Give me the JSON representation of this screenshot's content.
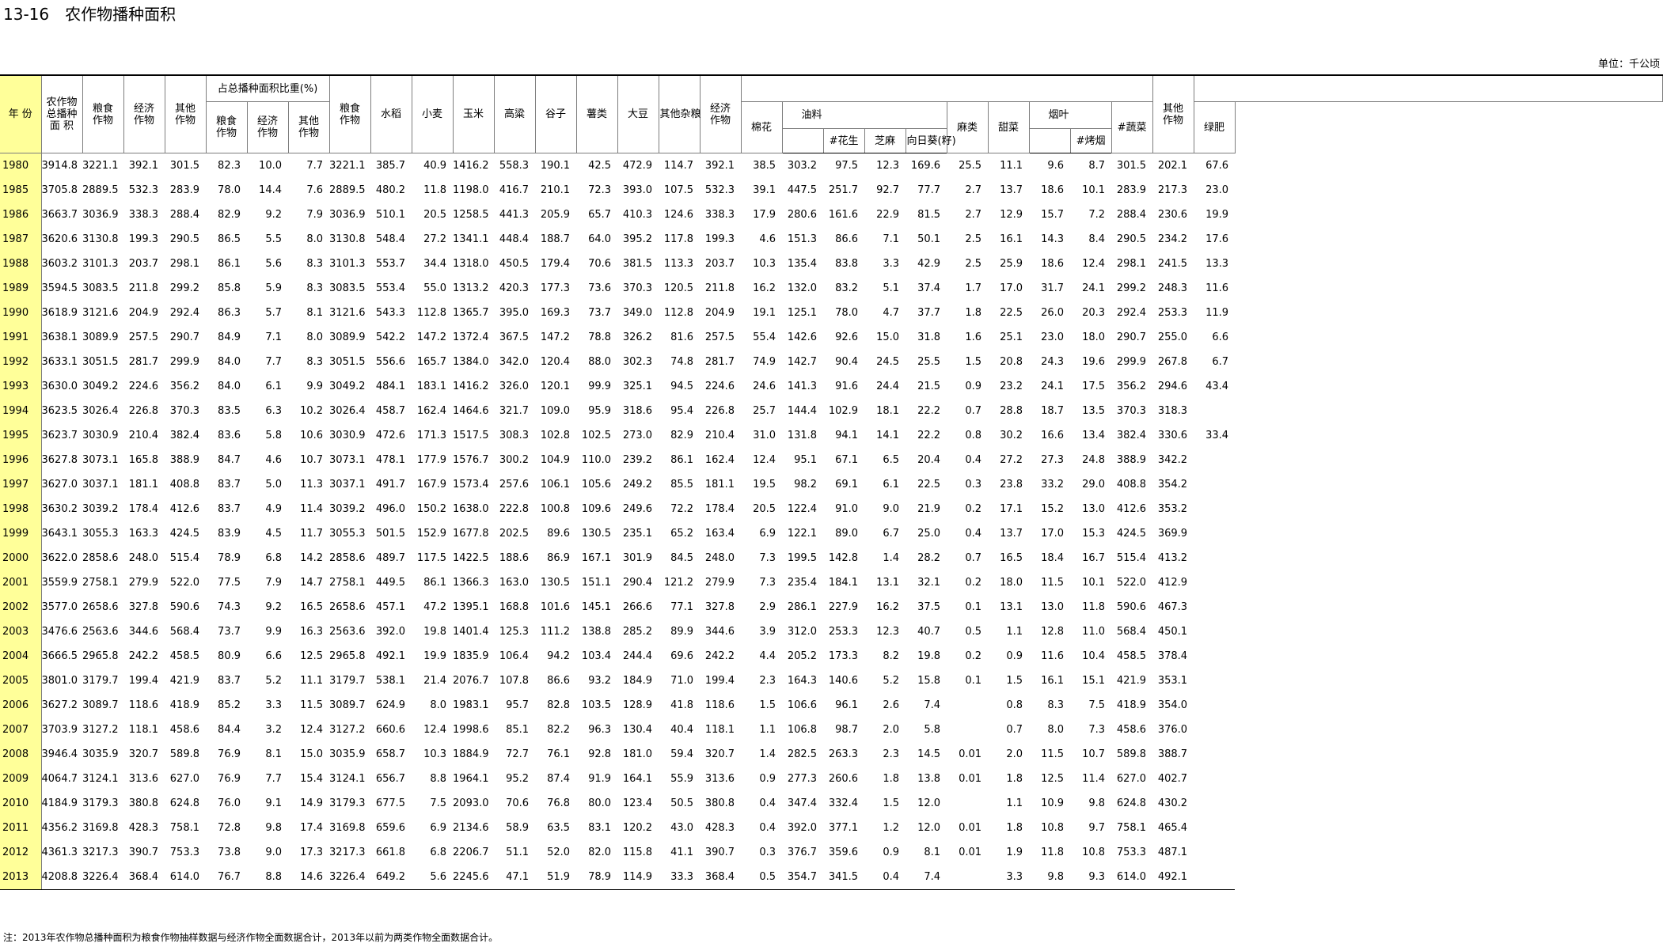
{
  "title": "13-16　农作物播种面积",
  "unit": "单位：千公顷",
  "headers": {
    "year": "年 份",
    "total": "农作物\n总播种\n面 积",
    "grain": "粮食\n作物",
    "economic": "经济\n作物",
    "other": "其他\n作物",
    "proportion_group": "占总播种面积比重(%)",
    "pct_grain": "粮食\n作物",
    "pct_economic": "经济\n作物",
    "pct_other": "其他\n作物",
    "grain2": "粮食\n作物",
    "rice": "水稻",
    "wheat": "小麦",
    "corn": "玉米",
    "sorghum": "高粱",
    "millet": "谷子",
    "tubers": "薯类",
    "soybean": "大豆",
    "other_grains": "其他杂粮",
    "economic2": "经济\n作物",
    "cotton": "棉花",
    "oil": "油料",
    "peanut": "#花生",
    "sesame": "芝麻",
    "sunflower": "向日葵(籽)",
    "hemp": "麻类",
    "beet": "甜菜",
    "tobacco": "烟叶",
    "flue_tobacco": "#烤烟",
    "other2": "其他\n作物",
    "vegetables": "#蔬菜",
    "green_manure": "绿肥"
  },
  "rows": [
    [
      "1980",
      "3914.8",
      "3221.1",
      "392.1",
      "301.5",
      "82.3",
      "10.0",
      "7.7",
      "3221.1",
      "385.7",
      "40.9",
      "1416.2",
      "558.3",
      "190.1",
      "42.5",
      "472.9",
      "114.7",
      "392.1",
      "38.5",
      "303.2",
      "97.5",
      "12.3",
      "169.6",
      "25.5",
      "11.1",
      "9.6",
      "8.7",
      "301.5",
      "202.1",
      "67.6"
    ],
    [
      "1985",
      "3705.8",
      "2889.5",
      "532.3",
      "283.9",
      "78.0",
      "14.4",
      "7.6",
      "2889.5",
      "480.2",
      "11.8",
      "1198.0",
      "416.7",
      "210.1",
      "72.3",
      "393.0",
      "107.5",
      "532.3",
      "39.1",
      "447.5",
      "251.7",
      "92.7",
      "77.7",
      "2.7",
      "13.7",
      "18.6",
      "10.1",
      "283.9",
      "217.3",
      "23.0"
    ],
    [
      "1986",
      "3663.7",
      "3036.9",
      "338.3",
      "288.4",
      "82.9",
      "9.2",
      "7.9",
      "3036.9",
      "510.1",
      "20.5",
      "1258.5",
      "441.3",
      "205.9",
      "65.7",
      "410.3",
      "124.6",
      "338.3",
      "17.9",
      "280.6",
      "161.6",
      "22.9",
      "81.5",
      "2.7",
      "12.9",
      "15.7",
      "7.2",
      "288.4",
      "230.6",
      "19.9"
    ],
    [
      "1987",
      "3620.6",
      "3130.8",
      "199.3",
      "290.5",
      "86.5",
      "5.5",
      "8.0",
      "3130.8",
      "548.4",
      "27.2",
      "1341.1",
      "448.4",
      "188.7",
      "64.0",
      "395.2",
      "117.8",
      "199.3",
      "4.6",
      "151.3",
      "86.6",
      "7.1",
      "50.1",
      "2.5",
      "16.1",
      "14.3",
      "8.4",
      "290.5",
      "234.2",
      "17.6"
    ],
    [
      "1988",
      "3603.2",
      "3101.3",
      "203.7",
      "298.1",
      "86.1",
      "5.6",
      "8.3",
      "3101.3",
      "553.7",
      "34.4",
      "1318.0",
      "450.5",
      "179.4",
      "70.6",
      "381.5",
      "113.3",
      "203.7",
      "10.3",
      "135.4",
      "83.8",
      "3.3",
      "42.9",
      "2.5",
      "25.9",
      "18.6",
      "12.4",
      "298.1",
      "241.5",
      "13.3"
    ],
    [
      "1989",
      "3594.5",
      "3083.5",
      "211.8",
      "299.2",
      "85.8",
      "5.9",
      "8.3",
      "3083.5",
      "553.4",
      "55.0",
      "1313.2",
      "420.3",
      "177.3",
      "73.6",
      "370.3",
      "120.5",
      "211.8",
      "16.2",
      "132.0",
      "83.2",
      "5.1",
      "37.4",
      "1.7",
      "17.0",
      "31.7",
      "24.1",
      "299.2",
      "248.3",
      "11.6"
    ],
    [
      "1990",
      "3618.9",
      "3121.6",
      "204.9",
      "292.4",
      "86.3",
      "5.7",
      "8.1",
      "3121.6",
      "543.3",
      "112.8",
      "1365.7",
      "395.0",
      "169.3",
      "73.7",
      "349.0",
      "112.8",
      "204.9",
      "19.1",
      "125.1",
      "78.0",
      "4.7",
      "37.7",
      "1.8",
      "22.5",
      "26.0",
      "20.3",
      "292.4",
      "253.3",
      "11.9"
    ],
    [
      "1991",
      "3638.1",
      "3089.9",
      "257.5",
      "290.7",
      "84.9",
      "7.1",
      "8.0",
      "3089.9",
      "542.2",
      "147.2",
      "1372.4",
      "367.5",
      "147.2",
      "78.8",
      "326.2",
      "81.6",
      "257.5",
      "55.4",
      "142.6",
      "92.6",
      "15.0",
      "31.8",
      "1.6",
      "25.1",
      "23.0",
      "18.0",
      "290.7",
      "255.0",
      "6.6"
    ],
    [
      "1992",
      "3633.1",
      "3051.5",
      "281.7",
      "299.9",
      "84.0",
      "7.7",
      "8.3",
      "3051.5",
      "556.6",
      "165.7",
      "1384.0",
      "342.0",
      "120.4",
      "88.0",
      "302.3",
      "74.8",
      "281.7",
      "74.9",
      "142.7",
      "90.4",
      "24.5",
      "25.5",
      "1.5",
      "20.8",
      "24.3",
      "19.6",
      "299.9",
      "267.8",
      "6.7"
    ],
    [
      "1993",
      "3630.0",
      "3049.2",
      "224.6",
      "356.2",
      "84.0",
      "6.1",
      "9.9",
      "3049.2",
      "484.1",
      "183.1",
      "1416.2",
      "326.0",
      "120.1",
      "99.9",
      "325.1",
      "94.5",
      "224.6",
      "24.6",
      "141.3",
      "91.6",
      "24.4",
      "21.5",
      "0.9",
      "23.2",
      "24.1",
      "17.5",
      "356.2",
      "294.6",
      "43.4"
    ],
    [
      "1994",
      "3623.5",
      "3026.4",
      "226.8",
      "370.3",
      "83.5",
      "6.3",
      "10.2",
      "3026.4",
      "458.7",
      "162.4",
      "1464.6",
      "321.7",
      "109.0",
      "95.9",
      "318.6",
      "95.4",
      "226.8",
      "25.7",
      "144.4",
      "102.9",
      "18.1",
      "22.2",
      "0.7",
      "28.8",
      "18.7",
      "13.5",
      "370.3",
      "318.3",
      ""
    ],
    [
      "1995",
      "3623.7",
      "3030.9",
      "210.4",
      "382.4",
      "83.6",
      "5.8",
      "10.6",
      "3030.9",
      "472.6",
      "171.3",
      "1517.5",
      "308.3",
      "102.8",
      "102.5",
      "273.0",
      "82.9",
      "210.4",
      "31.0",
      "131.8",
      "94.1",
      "14.1",
      "22.2",
      "0.8",
      "30.2",
      "16.6",
      "13.4",
      "382.4",
      "330.6",
      "33.4"
    ],
    [
      "1996",
      "3627.8",
      "3073.1",
      "165.8",
      "388.9",
      "84.7",
      "4.6",
      "10.7",
      "3073.1",
      "478.1",
      "177.9",
      "1576.7",
      "300.2",
      "104.9",
      "110.0",
      "239.2",
      "86.1",
      "162.4",
      "12.4",
      "95.1",
      "67.1",
      "6.5",
      "20.4",
      "0.4",
      "27.2",
      "27.3",
      "24.8",
      "388.9",
      "342.2",
      ""
    ],
    [
      "1997",
      "3627.0",
      "3037.1",
      "181.1",
      "408.8",
      "83.7",
      "5.0",
      "11.3",
      "3037.1",
      "491.7",
      "167.9",
      "1573.4",
      "257.6",
      "106.1",
      "105.6",
      "249.2",
      "85.5",
      "181.1",
      "19.5",
      "98.2",
      "69.1",
      "6.1",
      "22.5",
      "0.3",
      "23.8",
      "33.2",
      "29.0",
      "408.8",
      "354.2",
      ""
    ],
    [
      "1998",
      "3630.2",
      "3039.2",
      "178.4",
      "412.6",
      "83.7",
      "4.9",
      "11.4",
      "3039.2",
      "496.0",
      "150.2",
      "1638.0",
      "222.8",
      "100.8",
      "109.6",
      "249.6",
      "72.2",
      "178.4",
      "20.5",
      "122.4",
      "91.0",
      "9.0",
      "21.9",
      "0.2",
      "17.1",
      "15.2",
      "13.0",
      "412.6",
      "353.2",
      ""
    ],
    [
      "1999",
      "3643.1",
      "3055.3",
      "163.3",
      "424.5",
      "83.9",
      "4.5",
      "11.7",
      "3055.3",
      "501.5",
      "152.9",
      "1677.8",
      "202.5",
      "89.6",
      "130.5",
      "235.1",
      "65.2",
      "163.4",
      "6.9",
      "122.1",
      "89.0",
      "6.7",
      "25.0",
      "0.4",
      "13.7",
      "17.0",
      "15.3",
      "424.5",
      "369.9",
      ""
    ],
    [
      "2000",
      "3622.0",
      "2858.6",
      "248.0",
      "515.4",
      "78.9",
      "6.8",
      "14.2",
      "2858.6",
      "489.7",
      "117.5",
      "1422.5",
      "188.6",
      "86.9",
      "167.1",
      "301.9",
      "84.5",
      "248.0",
      "7.3",
      "199.5",
      "142.8",
      "1.4",
      "28.2",
      "0.7",
      "16.5",
      "18.4",
      "16.7",
      "515.4",
      "413.2",
      ""
    ],
    [
      "2001",
      "3559.9",
      "2758.1",
      "279.9",
      "522.0",
      "77.5",
      "7.9",
      "14.7",
      "2758.1",
      "449.5",
      "86.1",
      "1366.3",
      "163.0",
      "130.5",
      "151.1",
      "290.4",
      "121.2",
      "279.9",
      "7.3",
      "235.4",
      "184.1",
      "13.1",
      "32.1",
      "0.2",
      "18.0",
      "11.5",
      "10.1",
      "522.0",
      "412.9",
      ""
    ],
    [
      "2002",
      "3577.0",
      "2658.6",
      "327.8",
      "590.6",
      "74.3",
      "9.2",
      "16.5",
      "2658.6",
      "457.1",
      "47.2",
      "1395.1",
      "168.8",
      "101.6",
      "145.1",
      "266.6",
      "77.1",
      "327.8",
      "2.9",
      "286.1",
      "227.9",
      "16.2",
      "37.5",
      "0.1",
      "13.1",
      "13.0",
      "11.8",
      "590.6",
      "467.3",
      ""
    ],
    [
      "2003",
      "3476.6",
      "2563.6",
      "344.6",
      "568.4",
      "73.7",
      "9.9",
      "16.3",
      "2563.6",
      "392.0",
      "19.8",
      "1401.4",
      "125.3",
      "111.2",
      "138.8",
      "285.2",
      "89.9",
      "344.6",
      "3.9",
      "312.0",
      "253.3",
      "12.3",
      "40.7",
      "0.5",
      "1.1",
      "12.8",
      "11.0",
      "568.4",
      "450.1",
      ""
    ],
    [
      "2004",
      "3666.5",
      "2965.8",
      "242.2",
      "458.5",
      "80.9",
      "6.6",
      "12.5",
      "2965.8",
      "492.1",
      "19.9",
      "1835.9",
      "106.4",
      "94.2",
      "103.4",
      "244.4",
      "69.6",
      "242.2",
      "4.4",
      "205.2",
      "173.3",
      "8.2",
      "19.8",
      "0.2",
      "0.9",
      "11.6",
      "10.4",
      "458.5",
      "378.4",
      ""
    ],
    [
      "2005",
      "3801.0",
      "3179.7",
      "199.4",
      "421.9",
      "83.7",
      "5.2",
      "11.1",
      "3179.7",
      "538.1",
      "21.4",
      "2076.7",
      "107.8",
      "86.6",
      "93.2",
      "184.9",
      "71.0",
      "199.4",
      "2.3",
      "164.3",
      "140.6",
      "5.2",
      "15.8",
      "0.1",
      "1.5",
      "16.1",
      "15.1",
      "421.9",
      "353.1",
      ""
    ],
    [
      "2006",
      "3627.2",
      "3089.7",
      "118.6",
      "418.9",
      "85.2",
      "3.3",
      "11.5",
      "3089.7",
      "624.9",
      "8.0",
      "1983.1",
      "95.7",
      "82.8",
      "103.5",
      "128.9",
      "41.8",
      "118.6",
      "1.5",
      "106.6",
      "96.1",
      "2.6",
      "7.4",
      "",
      "0.8",
      "8.3",
      "7.5",
      "418.9",
      "354.0",
      ""
    ],
    [
      "2007",
      "3703.9",
      "3127.2",
      "118.1",
      "458.6",
      "84.4",
      "3.2",
      "12.4",
      "3127.2",
      "660.6",
      "12.4",
      "1998.6",
      "85.1",
      "82.2",
      "96.3",
      "130.4",
      "40.4",
      "118.1",
      "1.1",
      "106.8",
      "98.7",
      "2.0",
      "5.8",
      "",
      "0.7",
      "8.0",
      "7.3",
      "458.6",
      "376.0",
      ""
    ],
    [
      "2008",
      "3946.4",
      "3035.9",
      "320.7",
      "589.8",
      "76.9",
      "8.1",
      "15.0",
      "3035.9",
      "658.7",
      "10.3",
      "1884.9",
      "72.7",
      "76.1",
      "92.8",
      "181.0",
      "59.4",
      "320.7",
      "1.4",
      "282.5",
      "263.3",
      "2.3",
      "14.5",
      "0.01",
      "2.0",
      "11.5",
      "10.7",
      "589.8",
      "388.7",
      ""
    ],
    [
      "2009",
      "4064.7",
      "3124.1",
      "313.6",
      "627.0",
      "76.9",
      "7.7",
      "15.4",
      "3124.1",
      "656.7",
      "8.8",
      "1964.1",
      "95.2",
      "87.4",
      "91.9",
      "164.1",
      "55.9",
      "313.6",
      "0.9",
      "277.3",
      "260.6",
      "1.8",
      "13.8",
      "0.01",
      "1.8",
      "12.5",
      "11.4",
      "627.0",
      "402.7",
      ""
    ],
    [
      "2010",
      "4184.9",
      "3179.3",
      "380.8",
      "624.8",
      "76.0",
      "9.1",
      "14.9",
      "3179.3",
      "677.5",
      "7.5",
      "2093.0",
      "70.6",
      "76.8",
      "80.0",
      "123.4",
      "50.5",
      "380.8",
      "0.4",
      "347.4",
      "332.4",
      "1.5",
      "12.0",
      "",
      "1.1",
      "10.9",
      "9.8",
      "624.8",
      "430.2",
      ""
    ],
    [
      "2011",
      "4356.2",
      "3169.8",
      "428.3",
      "758.1",
      "72.8",
      "9.8",
      "17.4",
      "3169.8",
      "659.6",
      "6.9",
      "2134.6",
      "58.9",
      "63.5",
      "83.1",
      "120.2",
      "43.0",
      "428.3",
      "0.4",
      "392.0",
      "377.1",
      "1.2",
      "12.0",
      "0.01",
      "1.8",
      "10.8",
      "9.7",
      "758.1",
      "465.4",
      ""
    ],
    [
      "2012",
      "4361.3",
      "3217.3",
      "390.7",
      "753.3",
      "73.8",
      "9.0",
      "17.3",
      "3217.3",
      "661.8",
      "6.8",
      "2206.7",
      "51.1",
      "52.0",
      "82.0",
      "115.8",
      "41.1",
      "390.7",
      "0.3",
      "376.7",
      "359.6",
      "0.9",
      "8.1",
      "0.01",
      "1.9",
      "11.8",
      "10.8",
      "753.3",
      "487.1",
      ""
    ],
    [
      "2013",
      "4208.8",
      "3226.4",
      "368.4",
      "614.0",
      "76.7",
      "8.8",
      "14.6",
      "3226.4",
      "649.2",
      "5.6",
      "2245.6",
      "47.1",
      "51.9",
      "78.9",
      "114.9",
      "33.3",
      "368.4",
      "0.5",
      "354.7",
      "341.5",
      "0.4",
      "7.4",
      "",
      "3.3",
      "9.8",
      "9.3",
      "614.0",
      "492.1",
      ""
    ]
  ],
  "note": "注：2013年农作物总播种面积为粮食作物抽样数据与经济作物全面数据合计，2013年以前为两类作物全面数据合计。"
}
